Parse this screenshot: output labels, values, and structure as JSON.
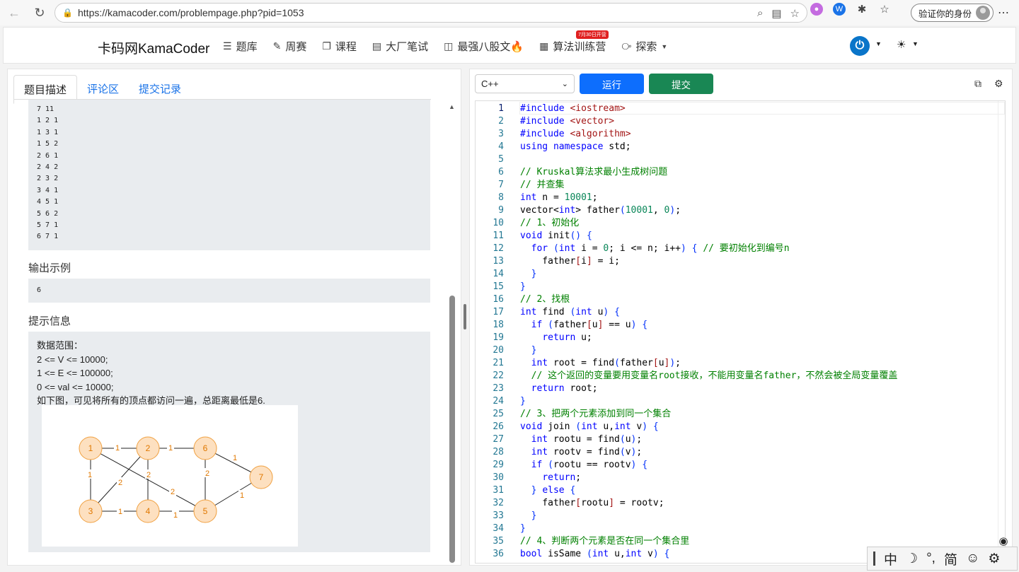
{
  "browser": {
    "url": "https://kamacoder.com/problempage.php?pid=1053",
    "profile_label": "验证你的身份"
  },
  "site": {
    "brand": "卡码网KamaCoder",
    "menu": [
      {
        "label": "题库",
        "icon": "list-icon"
      },
      {
        "label": "周赛",
        "icon": "pencil-icon"
      },
      {
        "label": "课程",
        "icon": "copy-icon"
      },
      {
        "label": "大厂笔试",
        "icon": "document-icon"
      },
      {
        "label": "最强八股文🔥",
        "icon": "book-icon"
      },
      {
        "label": "算法训练营",
        "icon": "calendar-icon",
        "badge": "7月30日开营"
      },
      {
        "label": "探索",
        "icon": "compass-icon"
      }
    ]
  },
  "tabs": [
    "题目描述",
    "评论区",
    "提交记录"
  ],
  "input_example_lines": [
    "7 11",
    "1 2 1",
    "1 3 1",
    "1 5 2",
    "2 6 1",
    "2 4 2",
    "2 3 2",
    "3 4 1",
    "4 5 1",
    "5 6 2",
    "5 7 1",
    "6 7 1"
  ],
  "output_title": "输出示例",
  "output_value": "6",
  "hint_title": "提示信息",
  "hint_lines": [
    "数据范围：",
    "2 <= V <= 10000;",
    "1 <= E <= 100000;",
    "0 <= val <= 10000;",
    "如下图，可见将所有的顶点都访问一遍，总距离最低是6."
  ],
  "graph": {
    "node_color": "#fde0c0",
    "node_stroke": "#f0a040",
    "label_color": "#e07800",
    "nodes": [
      "1",
      "2",
      "3",
      "4",
      "5",
      "6",
      "7"
    ],
    "edges": [
      {
        "from": "1",
        "to": "2",
        "weight": "1"
      },
      {
        "from": "1",
        "to": "3",
        "weight": "1"
      },
      {
        "from": "1",
        "to": "5",
        "weight": "2"
      },
      {
        "from": "2",
        "to": "6",
        "weight": "1"
      },
      {
        "from": "2",
        "to": "4",
        "weight": "2"
      },
      {
        "from": "2",
        "to": "3",
        "weight": "2"
      },
      {
        "from": "3",
        "to": "4",
        "weight": "1"
      },
      {
        "from": "4",
        "to": "5",
        "weight": "1"
      },
      {
        "from": "5",
        "to": "6",
        "weight": "2"
      },
      {
        "from": "5",
        "to": "7",
        "weight": "1"
      },
      {
        "from": "6",
        "to": "7",
        "weight": "1"
      }
    ]
  },
  "editor": {
    "language": "C++",
    "run_label": "运行",
    "submit_label": "提交",
    "lines": [
      "#include <iostream>",
      "#include <vector>",
      "#include <algorithm>",
      "using namespace std;",
      "",
      "// Kruskal算法求最小生成树问题",
      "// 并查集",
      "int n = 10001;",
      "vector<int> father(10001, 0);",
      "// 1、初始化",
      "void init() {",
      "  for (int i = 0; i <= n; i++) { // 要初始化到编号n",
      "    father[i] = i;",
      "  }",
      "}",
      "// 2、找根",
      "int find (int u) {",
      "  if (father[u] == u) {",
      "    return u;",
      "  }",
      "  int root = find(father[u]);",
      "  // 这个返回的变量要用变量名root接收，不能用变量名father，不然会被全局变量覆盖",
      "  return root;",
      "}",
      "// 3、把两个元素添加到同一个集合",
      "void join (int u,int v) {",
      "  int rootu = find(u);",
      "  int rootv = find(v);",
      "  if (rootu == rootv) {",
      "    return;",
      "  } else {",
      "    father[rootu] = rootv;",
      "  }",
      "}",
      "// 4、判断两个元素是否在同一个集合里",
      "bool isSame (int u,int v) {"
    ]
  },
  "ime": {
    "items": [
      "中",
      "☽",
      "°,",
      "简",
      "☺",
      "⚙"
    ]
  }
}
